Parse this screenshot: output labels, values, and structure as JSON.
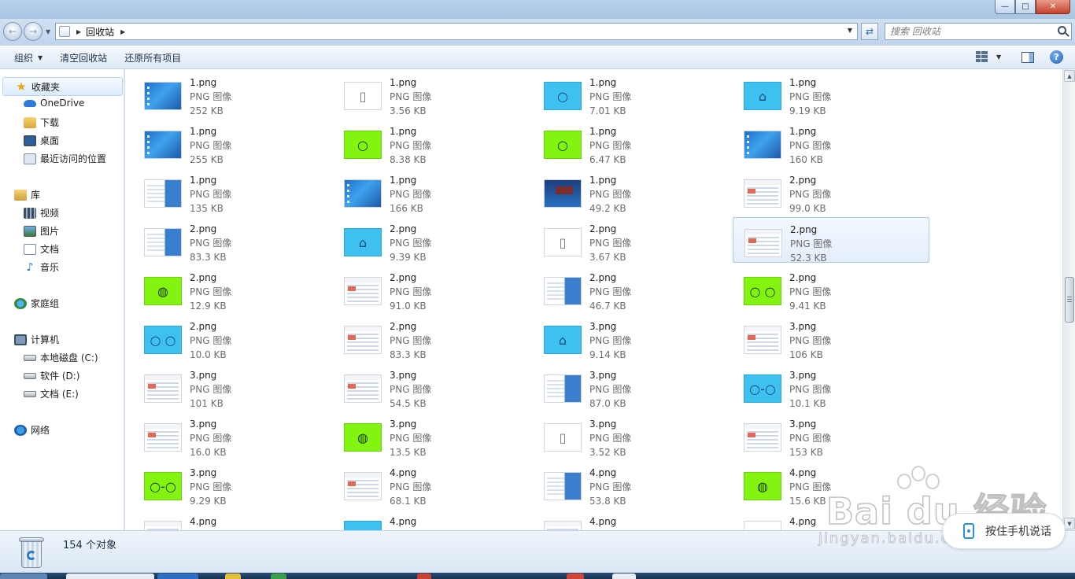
{
  "window": {
    "minimize_glyph": "—",
    "maximize_glyph": "□",
    "close_glyph": "✕"
  },
  "address": {
    "back_glyph": "←",
    "forward_glyph": "→",
    "crumb": "回收站",
    "separator_glyph": "▶",
    "dropdown_glyph": "▼",
    "refresh_glyph": "⇄"
  },
  "search": {
    "placeholder": "搜索 回收站"
  },
  "commands": {
    "organize": "组织",
    "empty_bin": "清空回收站",
    "restore_all": "还原所有项目",
    "caret": "▼",
    "help": "?"
  },
  "nav": {
    "favorites": {
      "label": "收藏夹",
      "items": [
        "OneDrive",
        "下载",
        "桌面",
        "最近访问的位置"
      ]
    },
    "libraries": {
      "label": "库",
      "items": [
        "视频",
        "图片",
        "文档",
        "音乐"
      ]
    },
    "homegroup": "家庭组",
    "computer": {
      "label": "计算机",
      "items": [
        "本地磁盘 (C:)",
        "软件 (D:)",
        "文档 (E:)"
      ]
    },
    "network": "网络"
  },
  "files": [
    {
      "name": "1.png",
      "type": "PNG 图像",
      "size": "252 KB",
      "thumb": "desk"
    },
    {
      "name": "1.png",
      "type": "PNG 图像",
      "size": "3.56 KB",
      "thumb": "white",
      "glyph": "▯"
    },
    {
      "name": "1.png",
      "type": "PNG 图像",
      "size": "7.01 KB",
      "thumb": "blue",
      "glyph": "○"
    },
    {
      "name": "1.png",
      "type": "PNG 图像",
      "size": "9.19 KB",
      "thumb": "blue",
      "glyph": "⌂"
    },
    {
      "name": "1.png",
      "type": "PNG 图像",
      "size": "255 KB",
      "thumb": "desk"
    },
    {
      "name": "1.png",
      "type": "PNG 图像",
      "size": "8.38 KB",
      "thumb": "green",
      "glyph": "○"
    },
    {
      "name": "1.png",
      "type": "PNG 图像",
      "size": "6.47 KB",
      "thumb": "green",
      "glyph": "○"
    },
    {
      "name": "1.png",
      "type": "PNG 图像",
      "size": "160 KB",
      "thumb": "desk"
    },
    {
      "name": "1.png",
      "type": "PNG 图像",
      "size": "135 KB",
      "thumb": "mix"
    },
    {
      "name": "1.png",
      "type": "PNG 图像",
      "size": "166 KB",
      "thumb": "desk"
    },
    {
      "name": "1.png",
      "type": "PNG 图像",
      "size": "49.2 KB",
      "thumb": "dark"
    },
    {
      "name": "2.png",
      "type": "PNG 图像",
      "size": "99.0 KB",
      "thumb": "shot"
    },
    {
      "name": "2.png",
      "type": "PNG 图像",
      "size": "83.3 KB",
      "thumb": "mix"
    },
    {
      "name": "2.png",
      "type": "PNG 图像",
      "size": "9.39 KB",
      "thumb": "blue",
      "glyph": "⌂"
    },
    {
      "name": "2.png",
      "type": "PNG 图像",
      "size": "3.67 KB",
      "thumb": "white",
      "glyph": "▯"
    },
    {
      "name": "2.png",
      "type": "PNG 图像",
      "size": "52.3 KB",
      "thumb": "shot",
      "selected": true
    },
    {
      "name": "2.png",
      "type": "PNG 图像",
      "size": "12.9 KB",
      "thumb": "green",
      "glyph": "◍"
    },
    {
      "name": "2.png",
      "type": "PNG 图像",
      "size": "91.0 KB",
      "thumb": "shot"
    },
    {
      "name": "2.png",
      "type": "PNG 图像",
      "size": "46.7 KB",
      "thumb": "mix"
    },
    {
      "name": "2.png",
      "type": "PNG 图像",
      "size": "9.41 KB",
      "thumb": "green",
      "glyph": "○ ○"
    },
    {
      "name": "2.png",
      "type": "PNG 图像",
      "size": "10.0 KB",
      "thumb": "blue",
      "glyph": "○ ○"
    },
    {
      "name": "2.png",
      "type": "PNG 图像",
      "size": "83.3 KB",
      "thumb": "shot"
    },
    {
      "name": "3.png",
      "type": "PNG 图像",
      "size": "9.14 KB",
      "thumb": "blue",
      "glyph": "⌂"
    },
    {
      "name": "3.png",
      "type": "PNG 图像",
      "size": "106 KB",
      "thumb": "shot"
    },
    {
      "name": "3.png",
      "type": "PNG 图像",
      "size": "101 KB",
      "thumb": "shot"
    },
    {
      "name": "3.png",
      "type": "PNG 图像",
      "size": "54.5 KB",
      "thumb": "shot"
    },
    {
      "name": "3.png",
      "type": "PNG 图像",
      "size": "87.0 KB",
      "thumb": "mix"
    },
    {
      "name": "3.png",
      "type": "PNG 图像",
      "size": "10.1 KB",
      "thumb": "blue",
      "glyph": "○-○"
    },
    {
      "name": "3.png",
      "type": "PNG 图像",
      "size": "16.0 KB",
      "thumb": "shot"
    },
    {
      "name": "3.png",
      "type": "PNG 图像",
      "size": "13.5 KB",
      "thumb": "green",
      "glyph": "◍"
    },
    {
      "name": "3.png",
      "type": "PNG 图像",
      "size": "3.52 KB",
      "thumb": "white",
      "glyph": "▯"
    },
    {
      "name": "3.png",
      "type": "PNG 图像",
      "size": "153 KB",
      "thumb": "shot"
    },
    {
      "name": "3.png",
      "type": "PNG 图像",
      "size": "9.29 KB",
      "thumb": "green",
      "glyph": "○-○"
    },
    {
      "name": "4.png",
      "type": "PNG 图像",
      "size": "68.1 KB",
      "thumb": "shot"
    },
    {
      "name": "4.png",
      "type": "PNG 图像",
      "size": "53.8 KB",
      "thumb": "mix"
    },
    {
      "name": "4.png",
      "type": "PNG 图像",
      "size": "15.6 KB",
      "thumb": "green",
      "glyph": "◍"
    },
    {
      "name": "4.png",
      "type": "",
      "size": "",
      "thumb": "shot"
    },
    {
      "name": "4.png",
      "type": "",
      "size": "",
      "thumb": "blue",
      "glyph": "⌂"
    },
    {
      "name": "4.png",
      "type": "",
      "size": "",
      "thumb": "shot"
    },
    {
      "name": "4.png",
      "type": "",
      "size": "",
      "thumb": "white",
      "glyph": "▯"
    }
  ],
  "details": {
    "item_count": "154 个对象"
  },
  "watermark": {
    "brand": "Bai du 经验",
    "url": "jingyan.baidu.com"
  },
  "voice": {
    "label": "按住手机说话"
  },
  "colors": {
    "accent": "#3ec0f0",
    "green_thumb": "#82f410",
    "selection_border": "#a9c8ec"
  }
}
